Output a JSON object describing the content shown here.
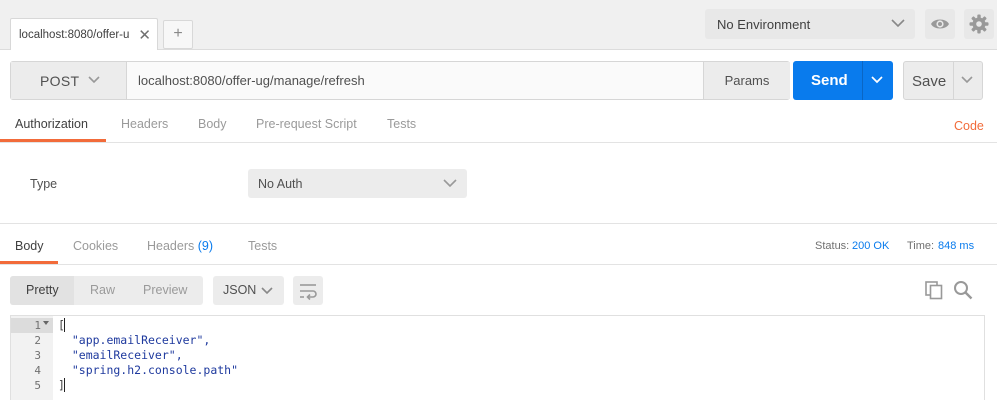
{
  "tab": {
    "label": "localhost:8080/offer-u",
    "close": "✕",
    "new": "+"
  },
  "environment": {
    "selected": "No Environment"
  },
  "request": {
    "method": "POST",
    "url": "localhost:8080/offer-ug/manage/refresh",
    "params_label": "Params",
    "send_label": "Send",
    "save_label": "Save"
  },
  "request_tabs": [
    "Authorization",
    "Headers",
    "Body",
    "Pre-request Script",
    "Tests"
  ],
  "code_link": "Code",
  "auth": {
    "type_label": "Type",
    "selected": "No Auth"
  },
  "response_tabs": {
    "body": "Body",
    "cookies": "Cookies",
    "headers": "Headers",
    "headers_count": "(9)",
    "tests": "Tests"
  },
  "status": {
    "label": "Status:",
    "value": "200 OK"
  },
  "time": {
    "label": "Time:",
    "value": "848 ms"
  },
  "view_modes": [
    "Pretty",
    "Raw",
    "Preview"
  ],
  "format": "JSON",
  "code": {
    "line_numbers": [
      "1",
      "2",
      "3",
      "4",
      "5"
    ],
    "lines": [
      "[",
      "  \"app.emailReceiver\",",
      "  \"emailReceiver\",",
      "  \"spring.h2.console.path\"",
      "]"
    ]
  },
  "colors": {
    "accent": "#f26b3a",
    "send": "#097bed",
    "link": "#097bed"
  }
}
